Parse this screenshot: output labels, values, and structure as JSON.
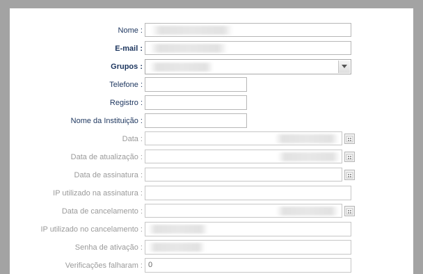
{
  "form": {
    "name_label": "Nome :",
    "email_label": "E-mail :",
    "groups_label": "Grupos :",
    "phone_label": "Telefone :",
    "registry_label": "Registro :",
    "institution_label": "Nome da Instituição :",
    "date_label": "Data :",
    "updated_date_label": "Data de atualização :",
    "signature_date_label": "Data de assinatura :",
    "signature_ip_label": "IP utilizado na assinatura :",
    "cancel_date_label": "Data de cancelamento :",
    "cancel_ip_label": "IP utilizado no cancelamento :",
    "activation_password_label": "Senha de ativação :",
    "failed_checks_label": "Verificações falharam :",
    "failed_checks_value": "0"
  },
  "colors": {
    "label_dark": "#1c355e",
    "label_gray": "#9a9a9a",
    "page_background": "#a3a3a3"
  },
  "icons": {
    "calendar": "calendar-icon",
    "dropdown": "chevron-down-icon"
  }
}
